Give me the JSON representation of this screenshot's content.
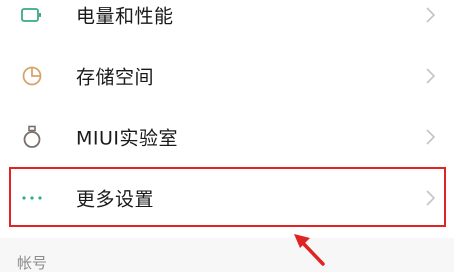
{
  "settings_list": {
    "items": [
      {
        "label": "电量和性能",
        "icon": "battery-icon"
      },
      {
        "label": "存储空间",
        "icon": "storage-pie-icon"
      },
      {
        "label": "MIUI实验室",
        "icon": "lab-flask-icon"
      },
      {
        "label": "更多设置",
        "icon": "more-dots-icon"
      }
    ]
  },
  "section": {
    "account_header": "帐号"
  },
  "colors": {
    "battery_icon": "#3aa889",
    "storage_icon": "#d9a46b",
    "lab_icon": "#7a6f6a",
    "more_icon": "#2fae8f",
    "highlight": "#e02424",
    "chevron": "#c4c4c4"
  }
}
